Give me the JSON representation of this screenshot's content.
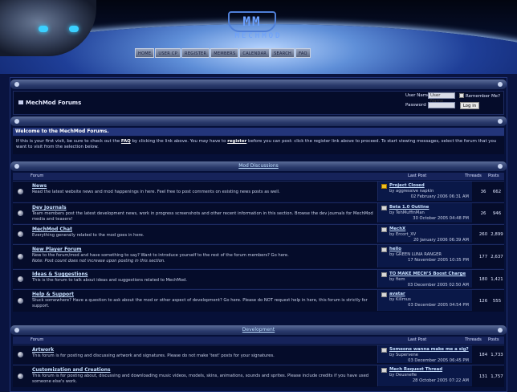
{
  "brand": {
    "logo_mark": "MM",
    "logo_text": "MECHMOD"
  },
  "nav": [
    "Home",
    "User CP",
    "Register",
    "Members",
    "Calendar",
    "Search",
    "FAQ"
  ],
  "site_title": "MechMod Forums",
  "login": {
    "user_label": "User Name",
    "user_value": "User Name",
    "password_label": "Password",
    "remember_label": "Remember Me?",
    "login_button": "Log in"
  },
  "welcome": {
    "title": "Welcome to the MechMod Forums.",
    "text_1": "If this is your first visit, be sure to check out the ",
    "faq": "FAQ",
    "text_2": " by clicking the link above. You may have to ",
    "register": "register",
    "text_3": " before you can post: click the register link above to proceed. To start viewing messages, select the forum that you want to visit from the selection below."
  },
  "columns": {
    "forum": "Forum",
    "last_post": "Last Post",
    "threads": "Threads",
    "posts": "Posts"
  },
  "categories": [
    {
      "name": "Mod Discussions",
      "forums": [
        {
          "name": "News",
          "desc": "Read the latest website news and mod happenings in here. Feel free to post comments on existing news posts as well.",
          "lp_title": "Project Closed",
          "lp_by": "by aggressive napkin",
          "lp_date": "02 February 2006 06:31 AM",
          "threads": "36",
          "posts": "662",
          "warn": true
        },
        {
          "name": "Dev Journals",
          "desc": "Team members post the latest development news, work in progress screenshots and other recent information in this section. Browse the dev journals for MechMod media and teasers!",
          "lp_title": "Beta 1.0 Outline",
          "lp_by": "by TehMuffinMan",
          "lp_date": "30 October 2005 04:48 PM",
          "threads": "26",
          "posts": "946",
          "warn": false
        },
        {
          "name": "MechMod Chat",
          "desc": "Everything generally related to the mod goes in here.",
          "lp_title": "MechX",
          "lp_by": "by Ercort_XV",
          "lp_date": "20 January 2006 06:39 AM",
          "threads": "260",
          "posts": "2,899",
          "warn": false
        },
        {
          "name": "New Player Forum",
          "desc": "New to the forum/mod and have something to say? Want to introduce yourself to the rest of the forum members? Go here.",
          "desc2": "Note: Post count does not increase upon posting in this section.",
          "lp_title": "hello",
          "lp_by": "by GREEN LUNA RANGER",
          "lp_date": "17 November 2005 10:35 PM",
          "threads": "177",
          "posts": "2,637",
          "warn": false
        },
        {
          "name": "Ideas & Suggestions",
          "desc": "This is the forum to talk about ideas and suggestions related to MechMod.",
          "lp_title": "TO MAKE MECH'S Boost Charge",
          "lp_by": "by fiem",
          "lp_date": "03 December 2005 02:50 AM",
          "threads": "180",
          "posts": "1,421",
          "warn": false
        },
        {
          "name": "Help & Support",
          "desc": "Stuck somewhere? Have a question to ask about the mod or other aspect of development? Go here. Please do NOT request help in here, this forum is strictly for support.",
          "lp_title": "avatar",
          "lp_by": "by Killmus",
          "lp_date": "03 December 2005 04:54 PM",
          "threads": "126",
          "posts": "555",
          "warn": false
        }
      ]
    },
    {
      "name": "Development",
      "forums": [
        {
          "name": "Artwork",
          "desc": "This forum is for posting and discussing artwork and signatures. Please do not make 'test' posts for your signatures.",
          "lp_title": "Someone wanna make me a sig?",
          "lp_by": "by Supervene",
          "lp_date": "03 December 2005 06:45 PM",
          "threads": "184",
          "posts": "1,733",
          "warn": false
        },
        {
          "name": "Customization and Creations",
          "desc": "This forum is for posting about, discussing and downloading music videos, models, skins, animations, sounds and sprites. Please include credits if you have used someone else's work.",
          "lp_title": "Mech Request Thread",
          "lp_by": "by Deusnefie",
          "lp_date": "28 October 2005 07:22 AM",
          "threads": "131",
          "posts": "1,757",
          "warn": false
        }
      ]
    }
  ]
}
